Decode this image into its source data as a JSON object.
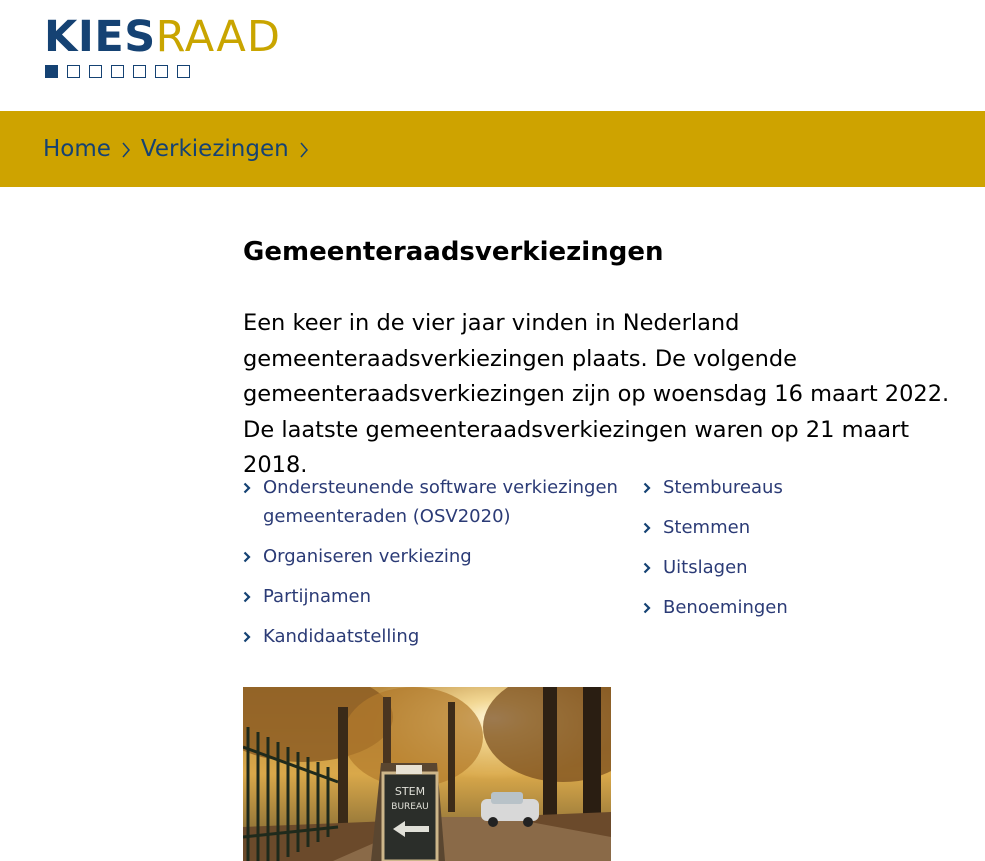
{
  "logo": {
    "part1": "KIES",
    "part2": "RAAD",
    "squares": 7
  },
  "breadcrumb": [
    {
      "label": "Home"
    },
    {
      "label": "Verkiezingen"
    }
  ],
  "page": {
    "title": "Gemeenteraadsverkiezingen",
    "intro": "Een keer in de vier jaar vinden in Nederland gemeenteraadsverkiezingen plaats. De volgende gemeenteraadsverkiezingen zijn op woensdag 16 maart 2022. De laatste gemeenteraadsverkiezingen waren op 21 maart 2018."
  },
  "links": {
    "left": [
      "Ondersteunende software verkiezingen gemeenteraden (OSV2020)",
      "Organiseren verkiezing",
      "Partijnamen",
      "Kandidaatstelling"
    ],
    "right": [
      "Stembureaus",
      "Stemmen",
      "Uitslagen",
      "Benoemingen"
    ]
  },
  "photo": {
    "sign_text_1": "STEM",
    "sign_text_2": "BUREAU"
  },
  "colors": {
    "brand_blue": "#154273",
    "brand_gold": "#cea300"
  }
}
